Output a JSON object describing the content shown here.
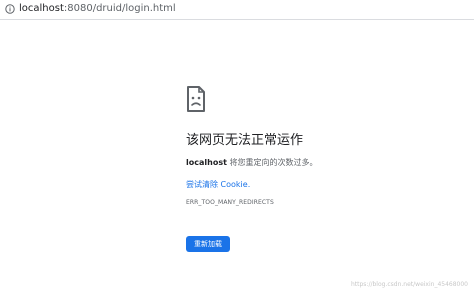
{
  "browser": {
    "url_host": "localhost",
    "url_rest": ":8080/druid/login.html"
  },
  "error": {
    "heading": "该网页无法正常运作",
    "description_host": "localhost",
    "description_rest": " 将您重定向的次数过多。",
    "suggestion": "尝试清除 Cookie.",
    "error_code": "ERR_TOO_MANY_REDIRECTS",
    "reload_label": "重新加载"
  },
  "watermark": "https://blog.csdn.net/weixin_45468000",
  "colors": {
    "accent": "#1a73e8",
    "heading": "#202124",
    "secondary": "#5f6368"
  }
}
